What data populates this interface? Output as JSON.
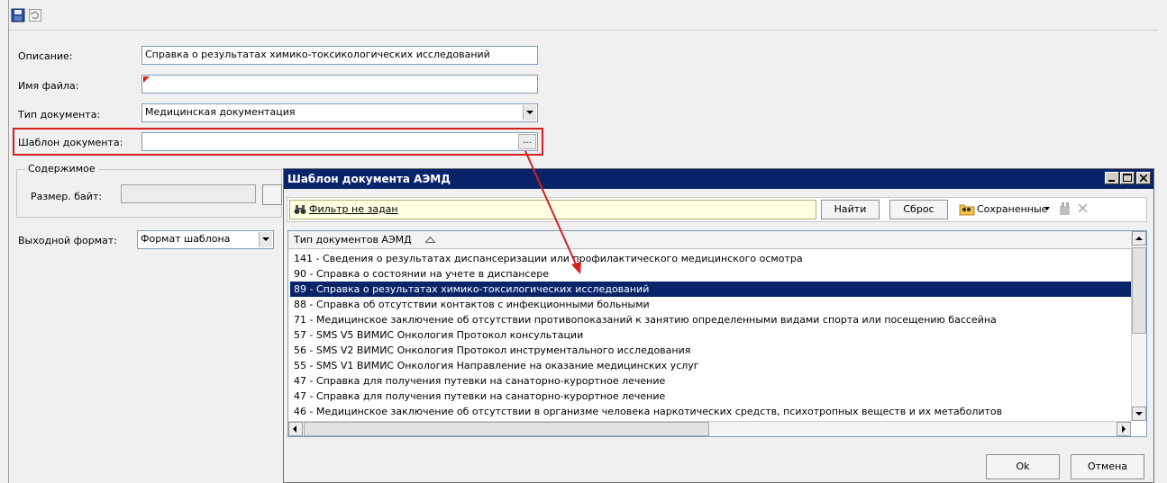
{
  "toolbar": {
    "save_icon": "save-icon",
    "refresh_icon": "refresh-icon"
  },
  "form": {
    "description_label": "Описание:",
    "description_value": "Справка о результатах химико-токсикологических исследований",
    "filename_label": "Имя файла:",
    "filename_value": "",
    "doctype_label": "Тип документа:",
    "doctype_value": "Медицинская документация",
    "template_label": "Шаблон документа:",
    "template_value": "",
    "template_button": "...",
    "content_group": "Содержимое",
    "size_label": "Размер. байт:",
    "size_value": "",
    "output_label": "Выходной формат:",
    "output_value": "Формат шаблона"
  },
  "dialog": {
    "title": "Шаблон документа АЭМД",
    "filter_text": "Фильтр не задан",
    "find_button": "Найти",
    "reset_button": "Сброс",
    "saved_button": "Сохраненные",
    "column_header": "Тип документов АЭМД",
    "rows": [
      "141 - Сведения о результатах диспансеризации или профилактического медицинского осмотра",
      "90 - Справка о состоянии на учете в диспансере",
      "89 - Справка о результатах химико-токсилогических исследований",
      "88 - Справка об отсутствии контактов с инфекционными больными",
      "71 - Медицинское заключение об отсутствии противопоказаний к занятию определенными видами спорта или посещению бассейна",
      "57 - SMS V5 ВИМИС Онкология Протокол консультации",
      "56 - SMS V2 ВИМИС Онкология Протокол инструментального исследования",
      "55 - SMS V1 ВИМИС Онкология Направление на оказание медицинских услуг",
      "47 - Справка для получения путевки на санаторно-курортное лечение",
      "47 - Справка для получения путевки на санаторно-курортное лечение",
      "46 - Медицинское заключение об отсутствии в организме человека наркотических средств, психотропных веществ и их метаболитов"
    ],
    "selected_index": 2,
    "ok_button": "Ok",
    "cancel_button": "Отмена"
  },
  "colors": {
    "selection": "#0a246a",
    "highlight": "#d42020",
    "title_bar": "#0a246a"
  }
}
